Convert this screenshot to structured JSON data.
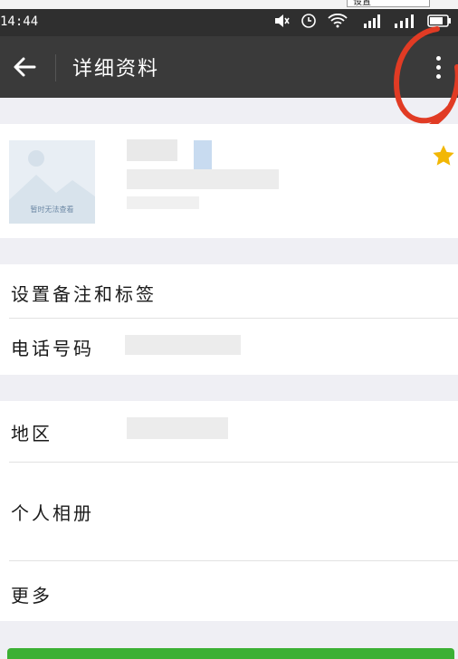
{
  "top_strip": {
    "tab_label": "设置"
  },
  "status_bar": {
    "time": "14:44"
  },
  "header": {
    "title": "详细资料"
  },
  "avatar": {
    "caption": "暂时无法查看"
  },
  "rows": {
    "remark": "设置备注和标签",
    "phone": "电话号码",
    "region": "地区",
    "album": "个人相册",
    "more": "更多"
  },
  "colors": {
    "app_bar": "#3a3a3a",
    "background": "#efeff4",
    "star": "#f2b705",
    "annotation": "#e13b24",
    "primary_button": "#3cb034"
  },
  "icons": [
    "back-arrow-icon",
    "more-vertical-icon",
    "star-icon",
    "mute-icon",
    "alarm-icon",
    "wifi-icon",
    "signal-icon",
    "battery-icon"
  ]
}
